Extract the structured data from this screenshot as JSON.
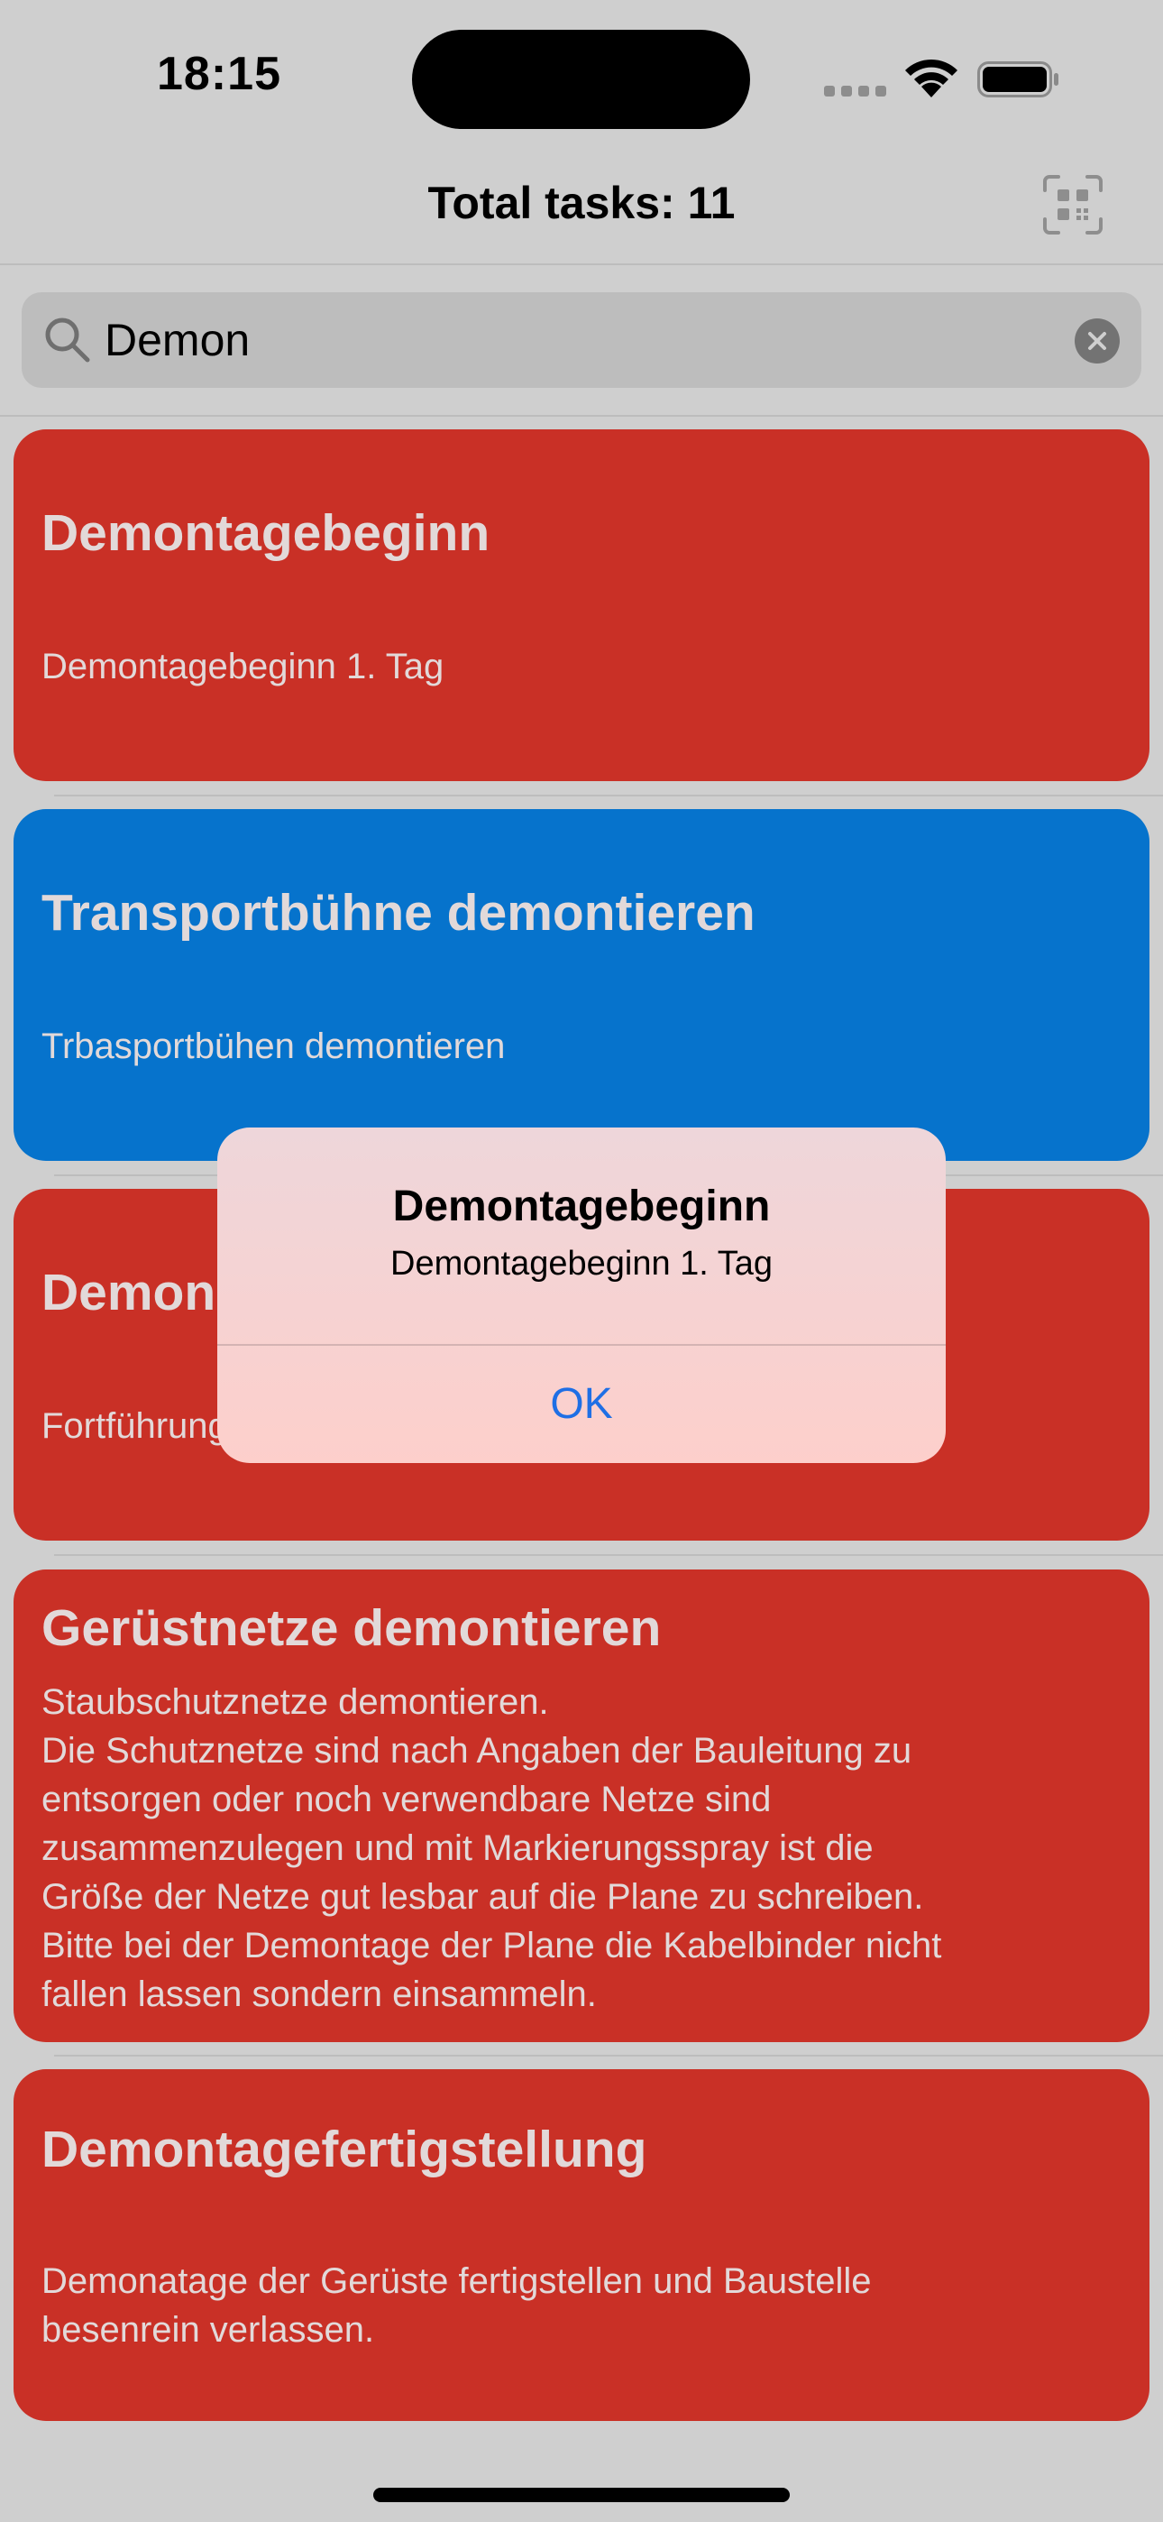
{
  "status_bar": {
    "time": "18:15"
  },
  "nav": {
    "title": "Total tasks: 11",
    "qr_icon": "qr-scan-icon"
  },
  "search": {
    "value": "Demon",
    "placeholder": "Search"
  },
  "tasks": [
    {
      "title": "Demontagebeginn",
      "description": "Demontagebeginn 1. Tag",
      "color": "#c93026"
    },
    {
      "title": "Transportbühne demontieren",
      "description": "Trbasportbühen demontieren",
      "color": "#0673cc"
    },
    {
      "title": "Demon",
      "description": "Fortführung",
      "color": "#c93026"
    },
    {
      "title": "Gerüstnetze demontieren",
      "description": "Staubschutznetze demontieren.\nDie Schutznetze sind nach Angaben der Bauleitung zu\nentsorgen oder noch verwendbare Netze sind\nzusammenzulegen und mit Markierungsspray ist die\nGröße der Netze gut lesbar auf die Plane zu schreiben.\nBitte bei der Demontage der Plane die Kabelbinder nicht\nfallen lassen sondern einsammeln.",
      "color": "#c93026"
    },
    {
      "title": "Demontagefertigstellung",
      "description": "Demonatage der Gerüste fertigstellen und Baustelle\nbesenrein verlassen.",
      "color": "#c93026"
    }
  ],
  "alert": {
    "title": "Demontagebeginn",
    "message": "Demontagebeginn 1. Tag",
    "ok_label": "OK"
  }
}
